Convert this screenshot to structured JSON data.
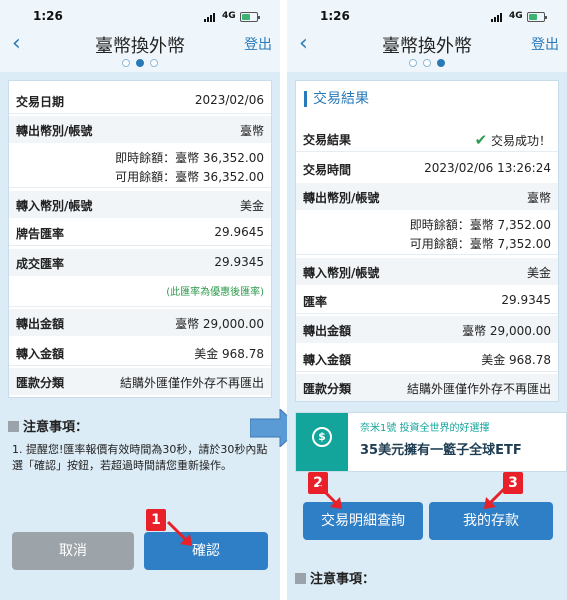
{
  "status": {
    "time": "1:26",
    "network": "4G"
  },
  "nav": {
    "back_icon": "chevron-left-icon",
    "title": "臺幣換外幣",
    "logout": "登出"
  },
  "left": {
    "rows": [
      {
        "label": "交易日期",
        "value": "2023/02/06"
      },
      {
        "label": "轉出幣別/帳號",
        "value": "臺幣"
      },
      {
        "label": "",
        "value": "即時餘額：臺幣 36,352.00"
      },
      {
        "label": "",
        "value": "可用餘額：臺幣 36,352.00"
      },
      {
        "label": "轉入幣別/帳號",
        "value": "美金"
      },
      {
        "label": "牌告匯率",
        "value": "29.9645"
      },
      {
        "label": "成交匯率",
        "value": "29.9345"
      },
      {
        "label": "",
        "value": "(此匯率為優惠後匯率)"
      },
      {
        "label": "轉出金額",
        "value": "臺幣 29,000.00"
      },
      {
        "label": "轉入金額",
        "value": "美金 968.78"
      },
      {
        "label": "匯款分類",
        "value": "結購外匯僅作外存不再匯出"
      }
    ],
    "notice_title": "注意事項：",
    "notice_text": "1.  提醒您!匯率報價有效時間為30秒，請於30秒內點選「確認」按鈕，若超過時間請您重新操作。",
    "cancel": "取消",
    "confirm": "確認",
    "badge": "1"
  },
  "right": {
    "section_title": "交易結果",
    "result_label": "交易結果",
    "result_value": "交易成功！",
    "rows": [
      {
        "label": "交易時間",
        "value": "2023/02/06 13:26:24"
      },
      {
        "label": "轉出幣別/帳號",
        "value": "臺幣"
      },
      {
        "label": "",
        "value": "即時餘額：臺幣 7,352.00"
      },
      {
        "label": "",
        "value": "可用餘額：臺幣 7,352.00"
      },
      {
        "label": "轉入幣別/帳號",
        "value": "美金"
      },
      {
        "label": "匯率",
        "value": "29.9345"
      },
      {
        "label": "轉出金額",
        "value": "臺幣 29,000.00"
      },
      {
        "label": "轉入金額",
        "value": "美金 968.78"
      },
      {
        "label": "匯款分類",
        "value": "結購外匯僅作外存不再匯出"
      }
    ],
    "banner_line1": "奈米1號 投資全世界的好選擇",
    "banner_line2": "35美元擁有一籃子全球ETF",
    "btn_detail": "交易明細查詢",
    "btn_deposit": "我的存款",
    "badge2": "2",
    "badge3": "3",
    "notice_title": "注意事項："
  },
  "colors": {
    "accent": "#2f7fc6",
    "badge": "#e8202a",
    "success": "#2e9a4d"
  }
}
